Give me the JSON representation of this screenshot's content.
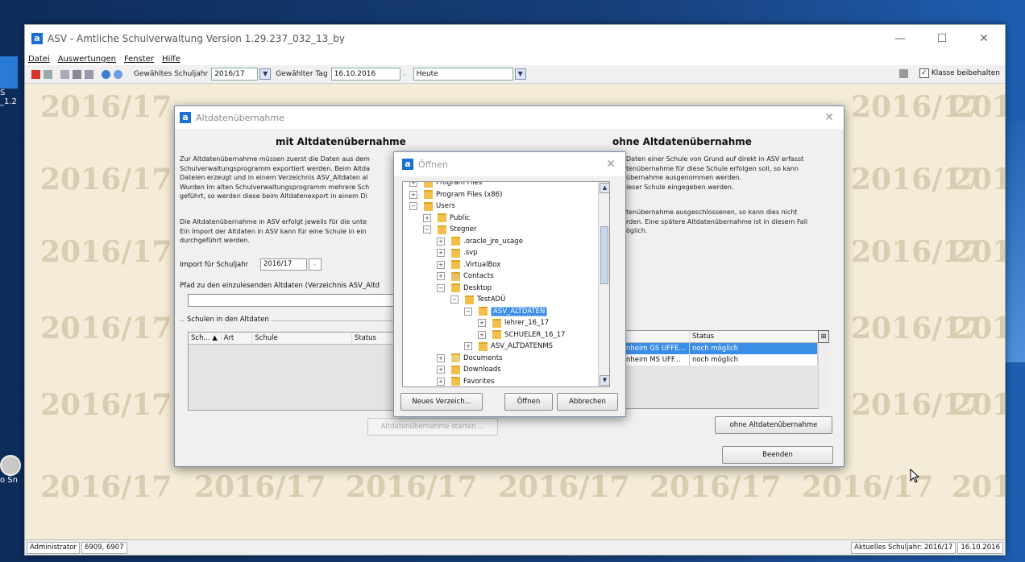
{
  "desktop": {
    "icon_a_label": "S",
    "icon_a_sub": "_1.2",
    "icon_b_label": "o Sn"
  },
  "window": {
    "title": "ASV - Amtliche Schulverwaltung Version 1.29.237_032_13_by",
    "controls": {
      "minimize": "—",
      "maximize": "☐",
      "close": "✕"
    }
  },
  "menu": [
    "Datei",
    "Auswertungen",
    "Fenster",
    "Hilfe"
  ],
  "toolbar": {
    "schuljahr_label": "Gewähltes Schuljahr",
    "schuljahr_value": "2016/17",
    "tag_label": "Gewählter Tag",
    "tag_value": "16.10.2016",
    "heute_value": "Heute",
    "klasse_checkbox": "Klasse beibehalten",
    "klasse_checked": true
  },
  "watermark": "2016/17",
  "watermark_cut": "201",
  "statusbar": {
    "user": "Administrator",
    "codes": "6909, 6907",
    "right": "Aktuelles Schuljahr: 2016/17",
    "date": "16.10.2016"
  },
  "altdaten_dialog": {
    "title": "Altdatenübernahme",
    "close": "✕",
    "left_heading": "mit Altdatenübernahme",
    "right_heading": "ohne Altdatenübernahme",
    "left_text_1": "Zur Altdatenübernahme müssen zuerst die Daten aus dem\nSchulverwaltungsprogramm exportiert werden. Beim Altda\nDateien erzeugt und in einem Verzeichnis ASV_Altdaten al\nWurden im alten Schulverwaltungsprogramm mehrere Sch\ngeführt, so werden diese beim Altdatenexport in einem Di",
    "left_text_2": "Die Altdatenübernahme in ASV erfolgt jeweils für die unte\nEin Import der Altdaten in ASV kann für eine Schule in ein\ndurchgeführt werden.",
    "right_text_1": "Daten einer Schule von Grund auf direkt in ASV erfasst\ntenübernahme für diese Schule erfolgen soll, so kann\nübernahme ausgenommen werden.\nieser Schule eingegeben werden.",
    "right_text_2": "tenübernahme ausgeschlossenen, so kann dies nicht\nrden. Eine spätere Altdatenübernahme ist in diesem Fall\nöglich.",
    "import_label": "Import für Schuljahr",
    "import_value": "2016/17",
    "path_label": "Pfad zu den einzulesenden Altdaten (Verzeichnis ASV_Altd",
    "schulen_legend": "Schulen in den Altdaten",
    "left_table_headers": [
      "Sch... ▲",
      "Art",
      "Schule",
      "Status"
    ],
    "right_table_header_status": "Status",
    "right_table_rows": [
      {
        "schule": "nheim GS UFFE...",
        "status": "noch möglich",
        "selected": true
      },
      {
        "schule": "nheim MS UFF...",
        "status": "noch möglich",
        "selected": false
      }
    ],
    "btn_start": "Altdatenübernahme starten ...",
    "btn_ohne": "ohne Altdatenübernahme",
    "btn_beenden": "Beenden"
  },
  "open_dialog": {
    "title": "Öffnen",
    "close": "✕",
    "tree": [
      {
        "label": "Program Files",
        "level": 1,
        "exp": "+",
        "type": "folder"
      },
      {
        "label": "Program Files (x86)",
        "level": 1,
        "exp": "+",
        "type": "folder"
      },
      {
        "label": "Users",
        "level": 1,
        "exp": "−",
        "type": "folder"
      },
      {
        "label": "Public",
        "level": 2,
        "exp": "+",
        "type": "folder"
      },
      {
        "label": "Stegner",
        "level": 2,
        "exp": "−",
        "type": "folder"
      },
      {
        "label": ".oracle_jre_usage",
        "level": 3,
        "exp": "+",
        "type": "folder"
      },
      {
        "label": ".svp",
        "level": 3,
        "exp": "+",
        "type": "folder"
      },
      {
        "label": ".VirtualBox",
        "level": 3,
        "exp": "+",
        "type": "folder"
      },
      {
        "label": "Contacts",
        "level": 3,
        "exp": "+",
        "type": "contacts"
      },
      {
        "label": "Desktop",
        "level": 3,
        "exp": "−",
        "type": "folder"
      },
      {
        "label": "TestADÜ",
        "level": 4,
        "exp": "−",
        "type": "folder"
      },
      {
        "label": "ASV_ALTDATEN",
        "level": 5,
        "exp": "−",
        "type": "folder",
        "selected": true
      },
      {
        "label": "lehrer_16_17",
        "level": 6,
        "exp": "+",
        "type": "folder"
      },
      {
        "label": "SCHUELER_16_17",
        "level": 6,
        "exp": "+",
        "type": "folder"
      },
      {
        "label": "ASV_ALTDATENMS",
        "level": 5,
        "exp": "+",
        "type": "folder"
      },
      {
        "label": "Documents",
        "level": 3,
        "exp": "+",
        "type": "docs"
      },
      {
        "label": "Downloads",
        "level": 3,
        "exp": "+",
        "type": "folder"
      },
      {
        "label": "Favorites",
        "level": 3,
        "exp": "+",
        "type": "folder"
      }
    ],
    "btn_new": "Neues Verzeich...",
    "btn_open": "Öffnen",
    "btn_cancel": "Abbrechen"
  }
}
